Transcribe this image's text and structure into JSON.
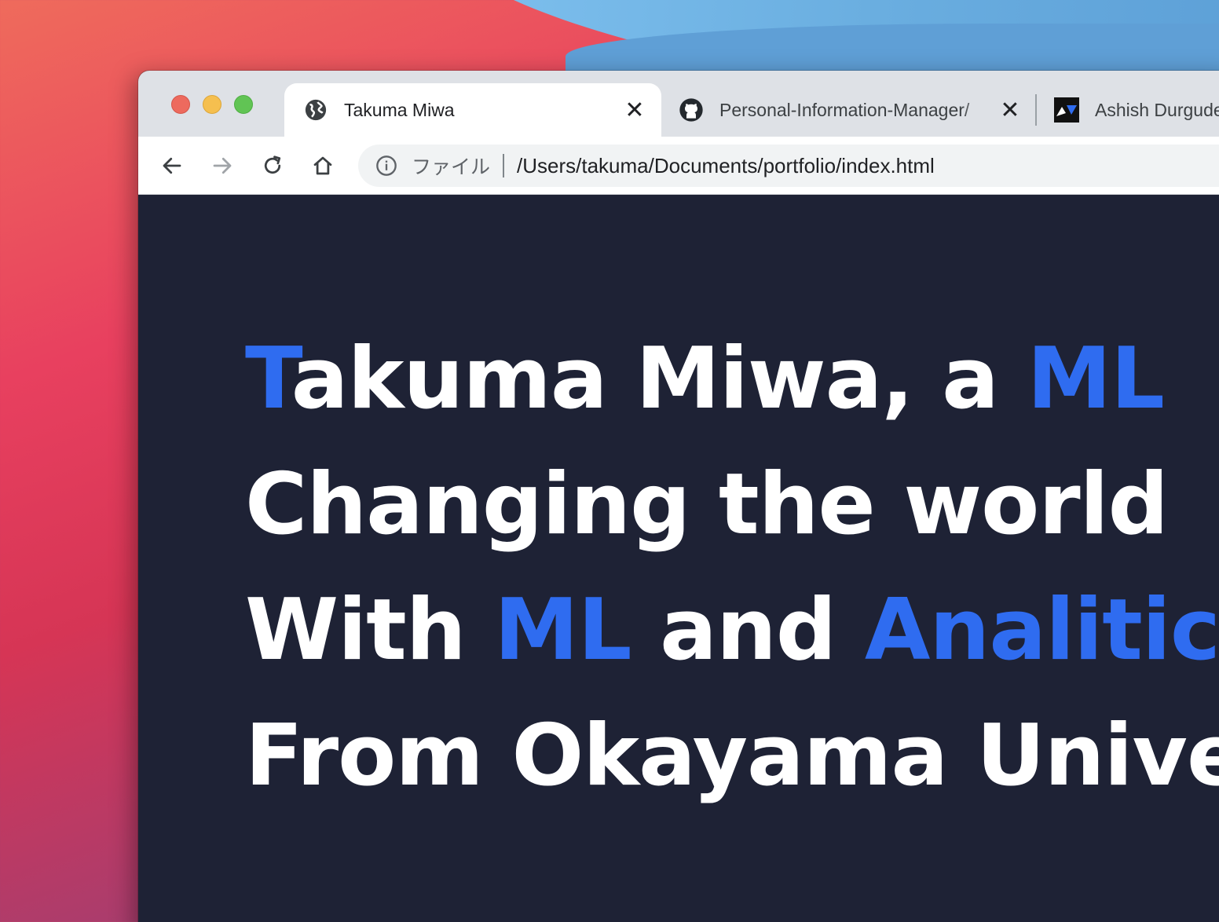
{
  "colors": {
    "accent": "#2f6cf0",
    "page_background": "#1e2235",
    "hero_text": "#ffffff"
  },
  "tabs": [
    {
      "title": "Takuma Miwa",
      "icon": "globe-icon",
      "active": true
    },
    {
      "title": "Personal-Information-Manager/",
      "icon": "github-icon",
      "active": false
    },
    {
      "title": "Ashish Durgude",
      "icon": "site-logo-icon",
      "active": false
    }
  ],
  "toolbar": {
    "back": "back-arrow-icon",
    "forward": "forward-arrow-icon",
    "reload": "reload-icon",
    "home": "home-icon"
  },
  "omnibox": {
    "scheme_label": "ファイル",
    "url": "/Users/takuma/Documents/portfolio/index.html"
  },
  "hero": {
    "line1": {
      "accent_initial": "T",
      "text": "akuma Miwa, a ",
      "accent": "ML"
    },
    "line2": {
      "text": "Changing the world"
    },
    "line3": {
      "prefix": "With ",
      "accent1": "ML",
      "middle": " and ",
      "accent2": "Analitics"
    },
    "line4": {
      "text": "From Okayama University"
    }
  }
}
